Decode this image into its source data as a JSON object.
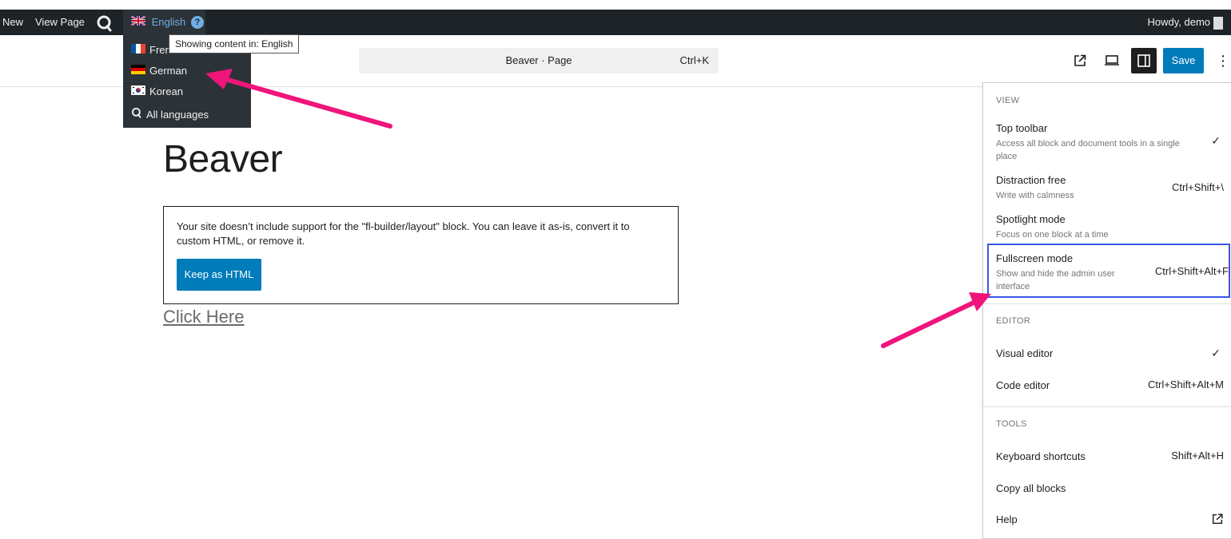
{
  "adminbar": {
    "new_label": "New",
    "view_page_label": "View Page",
    "language_label": "English",
    "language_help": "?",
    "howdy_label": "Howdy, demo"
  },
  "language_menu": {
    "tooltip": "Showing content in: English",
    "items": [
      {
        "label": "French",
        "flag": "fr"
      },
      {
        "label": "German",
        "flag": "de"
      },
      {
        "label": "Korean",
        "flag": "kr"
      }
    ],
    "all_languages_label": "All languages"
  },
  "header": {
    "command_title": "Beaver  · Page",
    "command_shortcut": "Ctrl+K",
    "save_label": "Save",
    "more_label": "⋮",
    "accent_color": "#007cba"
  },
  "content": {
    "post_title": "Beaver",
    "missing_block_message": "Your site doesn’t include support for the \"fl-builder/layout\" block. You can leave it as-is, convert it to custom HTML, or remove it.",
    "keep_html_label": "Keep as HTML",
    "link_text": "Click Here"
  },
  "options_menu": {
    "view_label": "View",
    "view_items": [
      {
        "label": "Top toolbar",
        "desc": "Access all block and document tools in a single place",
        "shortcut": "",
        "checked": true
      },
      {
        "label": "Distraction free",
        "desc": "Write with calmness",
        "shortcut": "Ctrl+Shift+\\",
        "checked": false
      },
      {
        "label": "Spotlight mode",
        "desc": "Focus on one block at a time",
        "shortcut": "",
        "checked": false
      },
      {
        "label": "Fullscreen mode",
        "desc": "Show and hide the admin user interface",
        "shortcut": "Ctrl+Shift+Alt+F",
        "checked": false
      }
    ],
    "editor_label": "Editor",
    "editor_items": [
      {
        "label": "Visual editor",
        "shortcut": "",
        "checked": true
      },
      {
        "label": "Code editor",
        "shortcut": "Ctrl+Shift+Alt+M",
        "checked": false
      }
    ],
    "tools_label": "Tools",
    "tools_items": [
      {
        "label": "Keyboard shortcuts",
        "shortcut": "Shift+Alt+H"
      },
      {
        "label": "Copy all blocks",
        "shortcut": ""
      },
      {
        "label": "Help",
        "shortcut": ""
      }
    ],
    "check_glyph": "✓"
  },
  "annotation_color": "#f0157a"
}
